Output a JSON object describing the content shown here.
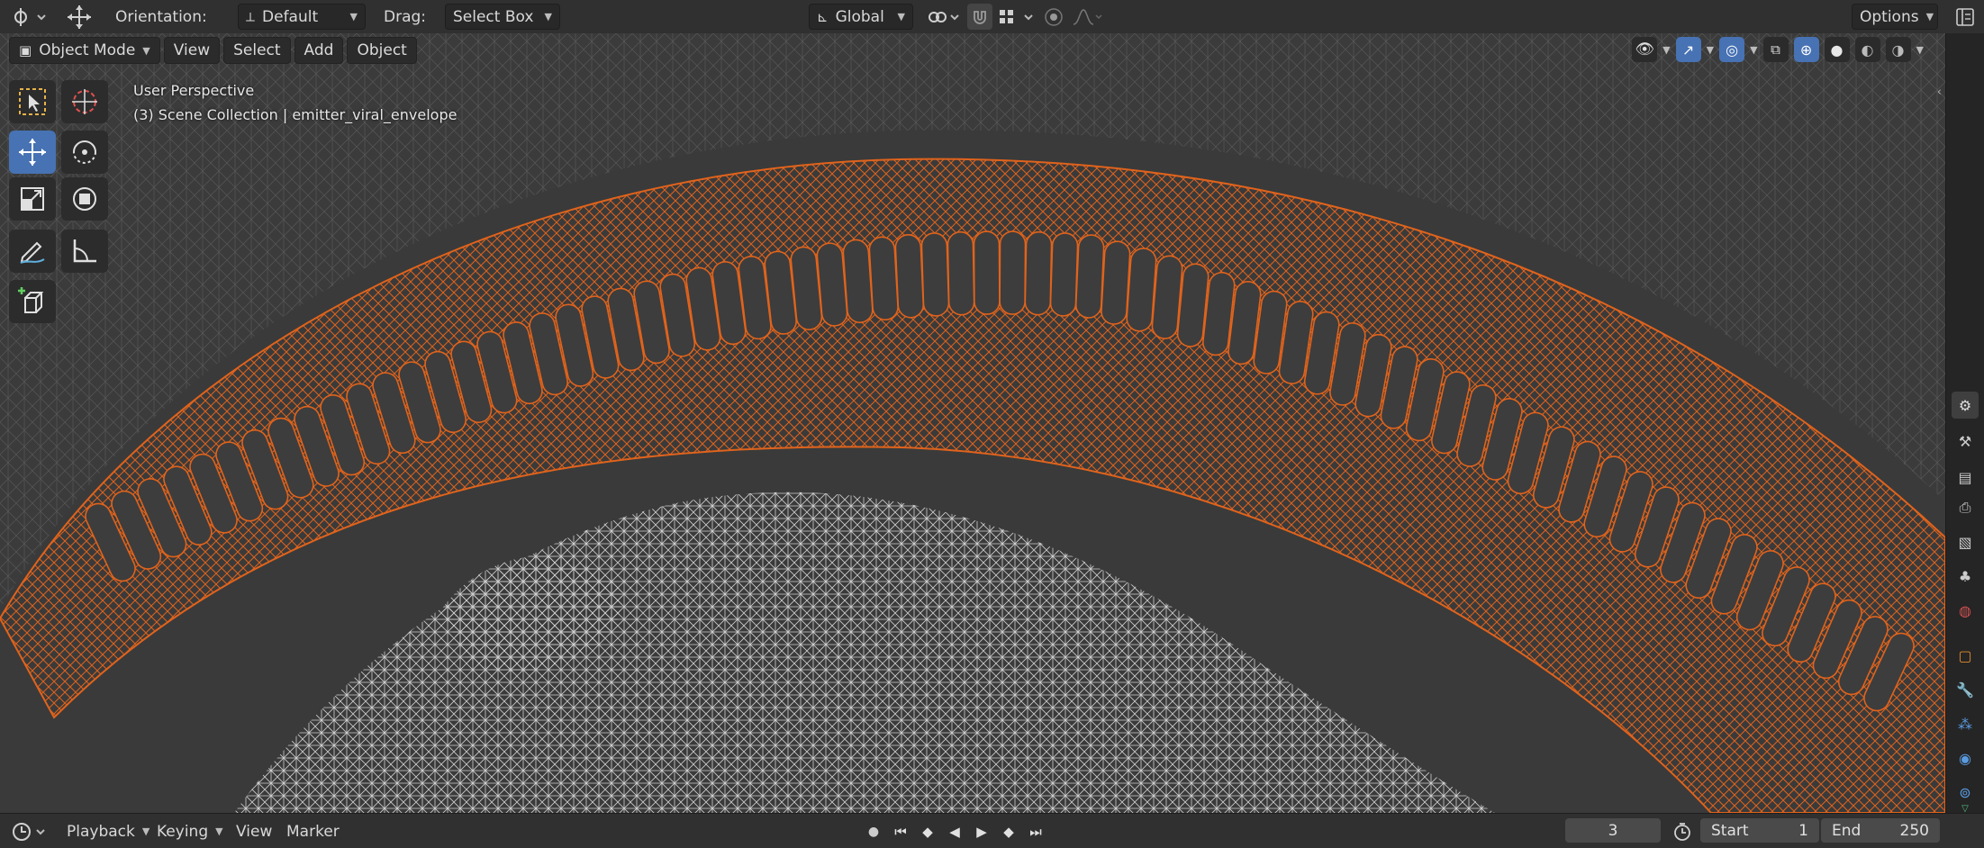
{
  "header": {
    "orientation_label": "Orientation:",
    "orientation_value": "Default",
    "drag_label": "Drag:",
    "drag_value": "Select Box",
    "transform_space": "Global",
    "options_label": "Options"
  },
  "viewport_header": {
    "mode": "Object Mode",
    "menus": [
      "View",
      "Select",
      "Add",
      "Object"
    ]
  },
  "overlay": {
    "perspective": "User Perspective",
    "collection": "(3) Scene Collection | emitter_viral_envelope"
  },
  "timeline": {
    "menus": [
      "Playback",
      "Keying",
      "View",
      "Marker"
    ],
    "current_frame": "3",
    "start_label": "Start",
    "start_value": "1",
    "end_label": "End",
    "end_value": "250"
  },
  "colors": {
    "selected_orange": "#e0631c",
    "wire_white": "#d8d8d8",
    "active_blue": "#4772b3",
    "viewport_bg": "#3b3b3b"
  }
}
